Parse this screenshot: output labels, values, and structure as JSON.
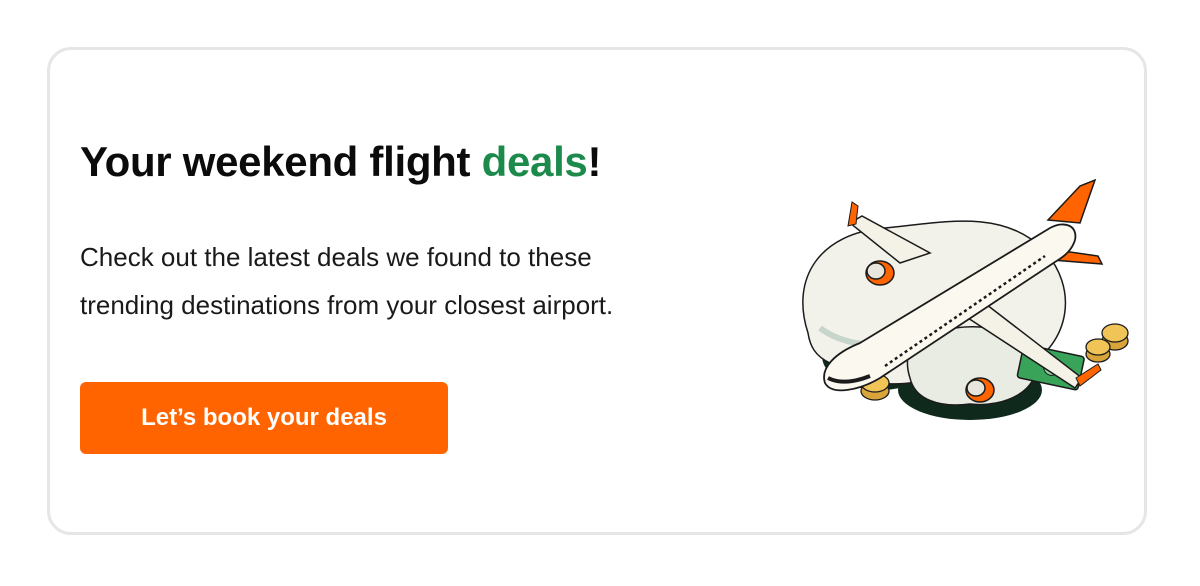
{
  "banner": {
    "headline_prefix": "Your weekend flight ",
    "headline_accent": "deals",
    "headline_suffix": "!",
    "body_line_1": "Check out the latest deals we found to these",
    "body_line_2": "trending destinations from your closest airport.",
    "cta_label": "Let’s book your deals",
    "illustration_icon": "airplane-with-money-icon"
  },
  "colors": {
    "accent_green": "#1c8a4a",
    "cta_orange": "#ff6400",
    "card_border": "#e6e6e6",
    "text_dark": "#0b0b0b"
  }
}
